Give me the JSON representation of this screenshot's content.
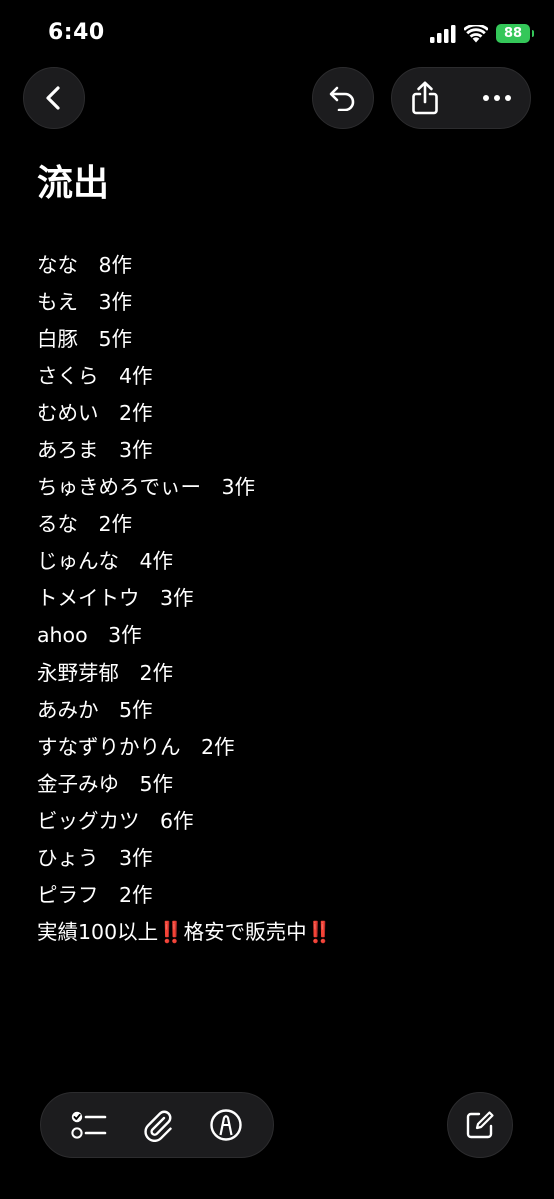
{
  "status_bar": {
    "time": "6:40",
    "battery": "88",
    "icons": [
      "signal-icon",
      "wifi-icon",
      "battery-icon"
    ]
  },
  "toolbar_top": {
    "icons": [
      "back-icon",
      "undo-icon",
      "share-icon",
      "more-icon"
    ]
  },
  "note": {
    "title": "流出",
    "lines": [
      "なな　8作",
      "もえ　3作",
      "白豚　5作",
      "さくら　4作",
      "むめい　2作",
      "あろま　3作",
      "ちゅきめろでぃー　3作",
      "るな　2作",
      "じゅんな　4作",
      "トメイトウ　3作",
      "ahoo　3作",
      "永野芽郁　2作",
      "あみか　5作",
      "すなずりかりん　2作",
      "金子みゆ　5作",
      "ビッグカツ　6作",
      "ひょう　3作",
      "ピラフ　2作",
      "実績100以上‼️格安で販売中‼️"
    ]
  },
  "bottom_toolbar": {
    "icons": [
      "checklist-icon",
      "paperclip-icon",
      "markup-icon",
      "compose-icon"
    ]
  },
  "colors": {
    "background": "#000000",
    "button_bg": "#1c1c1e",
    "battery": "#34c759",
    "text": "#ffffff"
  }
}
